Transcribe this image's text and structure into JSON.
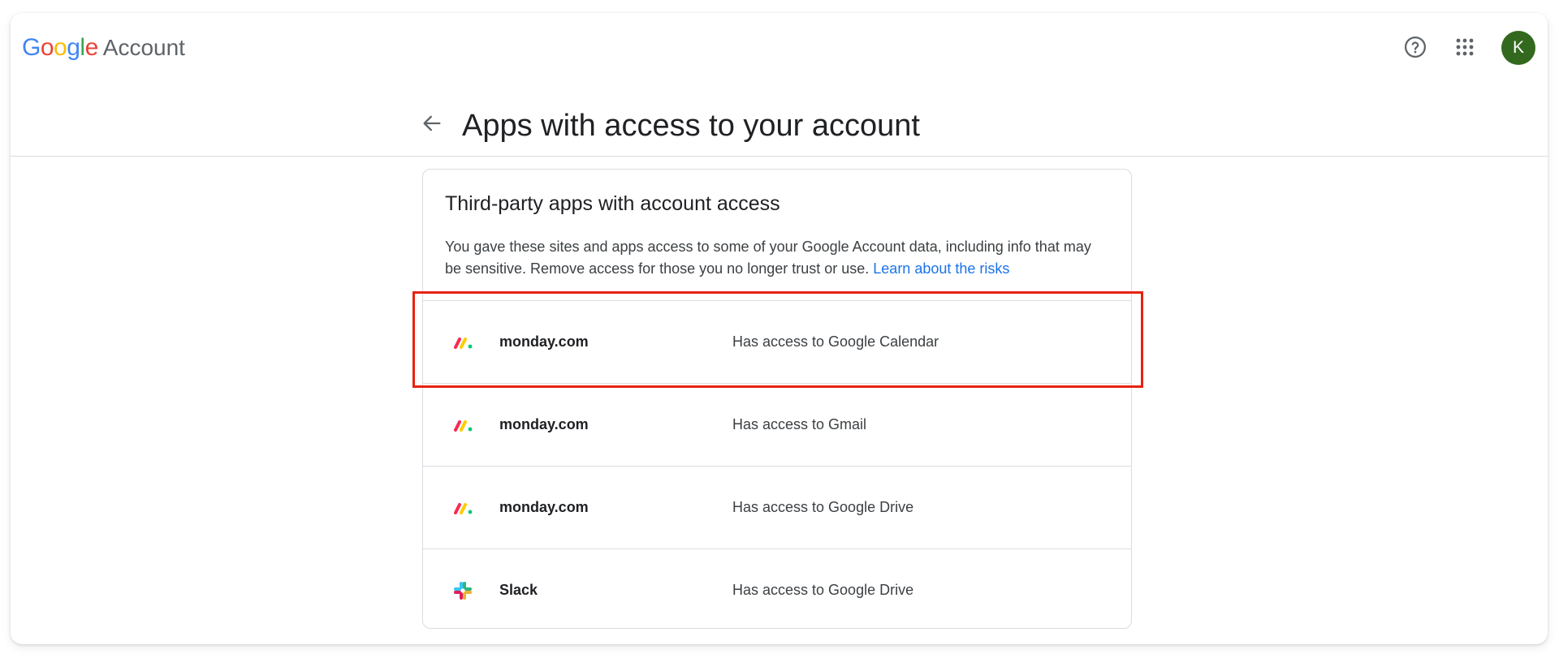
{
  "header": {
    "logo_word": [
      "G",
      "o",
      "o",
      "g",
      "l",
      "e"
    ],
    "product": "Account",
    "avatar_letter": "K",
    "help_icon": "help-circle-icon",
    "apps_icon": "apps-grid-icon"
  },
  "page": {
    "title": "Apps with access to your account",
    "back_icon": "arrow-back-icon"
  },
  "card": {
    "title": "Third-party apps with account access",
    "description": "You gave these sites and apps access to some of your Google Account data, including info that may be sensitive. Remove access for those you no longer trust or use.",
    "learn_link": "Learn about the risks"
  },
  "apps": [
    {
      "name": "monday.com",
      "access": "Has access to Google Calendar",
      "icon": "monday-logo-icon",
      "highlighted": true
    },
    {
      "name": "monday.com",
      "access": "Has access to Gmail",
      "icon": "monday-logo-icon"
    },
    {
      "name": "monday.com",
      "access": "Has access to Google Drive",
      "icon": "monday-logo-icon"
    },
    {
      "name": "Slack",
      "access": "Has access to Google Drive",
      "icon": "slack-logo-icon"
    }
  ],
  "colors": {
    "highlight": "#e8210e",
    "link": "#1a73e8",
    "avatar": "#33691e"
  }
}
